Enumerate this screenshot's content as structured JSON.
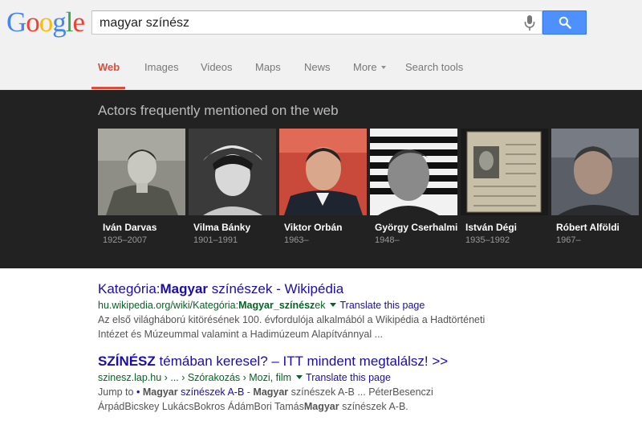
{
  "logo": {
    "letters": [
      "G",
      "o",
      "o",
      "g",
      "l",
      "e"
    ],
    "colors": [
      "#4285f4",
      "#ea4335",
      "#fbbc05",
      "#4285f4",
      "#34a853",
      "#ea4335"
    ]
  },
  "search": {
    "query": "magyar színész"
  },
  "nav": {
    "web": "Web",
    "images": "Images",
    "videos": "Videos",
    "maps": "Maps",
    "news": "News",
    "more": "More",
    "search_tools": "Search tools"
  },
  "carousel": {
    "heading": "Actors frequently mentioned on the web",
    "actors": [
      {
        "name": "Iván Darvas",
        "years": "1925–2007"
      },
      {
        "name": "Vilma Bánky",
        "years": "1901–1991"
      },
      {
        "name": "Viktor Orbán",
        "years": "1963–"
      },
      {
        "name": "György Cserhalmi",
        "years": "1948–"
      },
      {
        "name": "István Dégi",
        "years": "1935–1992"
      },
      {
        "name": "Róbert Alföldi",
        "years": "1967–"
      }
    ]
  },
  "results": [
    {
      "title_pre": "Kategória:",
      "title_bold": "Magyar",
      "title_post": " színészek - Wikipédia",
      "url_pre": "hu.wikipedia.org/wiki/Kategória:",
      "url_bold": "Magyar_színész",
      "url_post": "ek",
      "translate": "Translate this page",
      "snippet_line1": "Az első világháború kitörésének 100. évfordulója alkalmából a Wikipédia a Hadtörténeti",
      "snippet_line2": "Intézet és Múzeummal valamint a Hadimúzeum Alapítvánnyal ..."
    },
    {
      "title_bold": "SZÍNÉSZ",
      "title_post": " témában keresel? – ITT mindent megtalálsz! >>",
      "url_text": "szinesz.lap.hu › ... › Szórakozás › Mozi, film",
      "translate": "Translate this page",
      "jump_to": "Jump to",
      "jump_bullet": "•",
      "jump_link_bold": "Magyar",
      "jump_link_rest": " színészek A-B",
      "jump_mid": " - ",
      "jump_bold2": "Magyar",
      "jump_rest2": " színészek A-B ... PéterBesenczi",
      "line2_pre": "ÁrpádBicskey LukácsBokros ÁdámBori Tamás",
      "line2_bold": "Magyar",
      "line2_post": " színészek A-B."
    }
  ]
}
